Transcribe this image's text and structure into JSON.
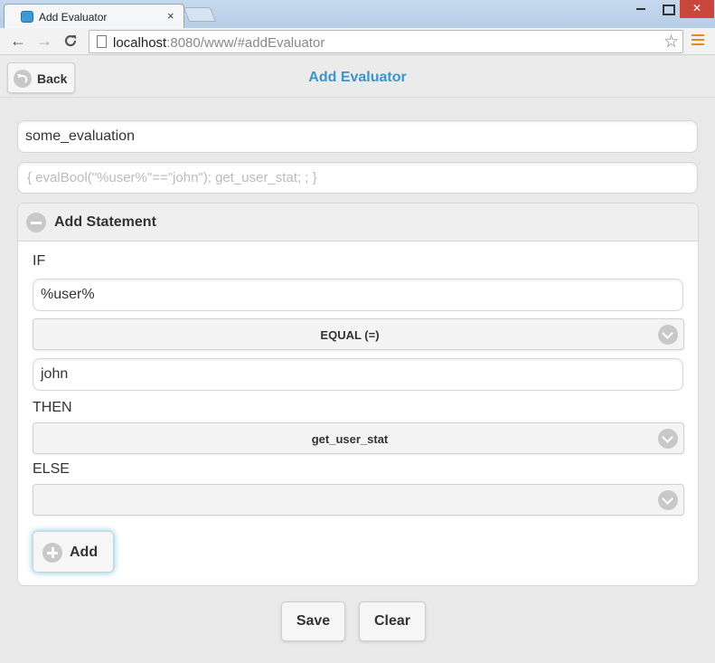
{
  "browser": {
    "tab_title": "Add Evaluator",
    "tab_close": "×",
    "url_host": "localhost",
    "url_rest": ":8080/www/#addEvaluator",
    "back_icon": "←",
    "forward_icon": "→",
    "reload_icon": "C",
    "bookmark_icon": "☆"
  },
  "header": {
    "back_label": "Back",
    "title": "Add Evaluator",
    "title_color": "#3a96c9"
  },
  "form": {
    "name_value": "some_evaluation",
    "expression_placeholder": "{ evalBool(\"%user%\"==\"john\"); get_user_stat;  ; }"
  },
  "statement": {
    "title": "Add Statement",
    "if_label": "IF",
    "if_value": "%user%",
    "operator": "EQUAL (=)",
    "compare_value": "john",
    "then_label": "THEN",
    "then_value": "get_user_stat",
    "else_label": "ELSE",
    "else_value": "",
    "add_label": "Add"
  },
  "actions": {
    "save_label": "Save",
    "clear_label": "Clear"
  }
}
